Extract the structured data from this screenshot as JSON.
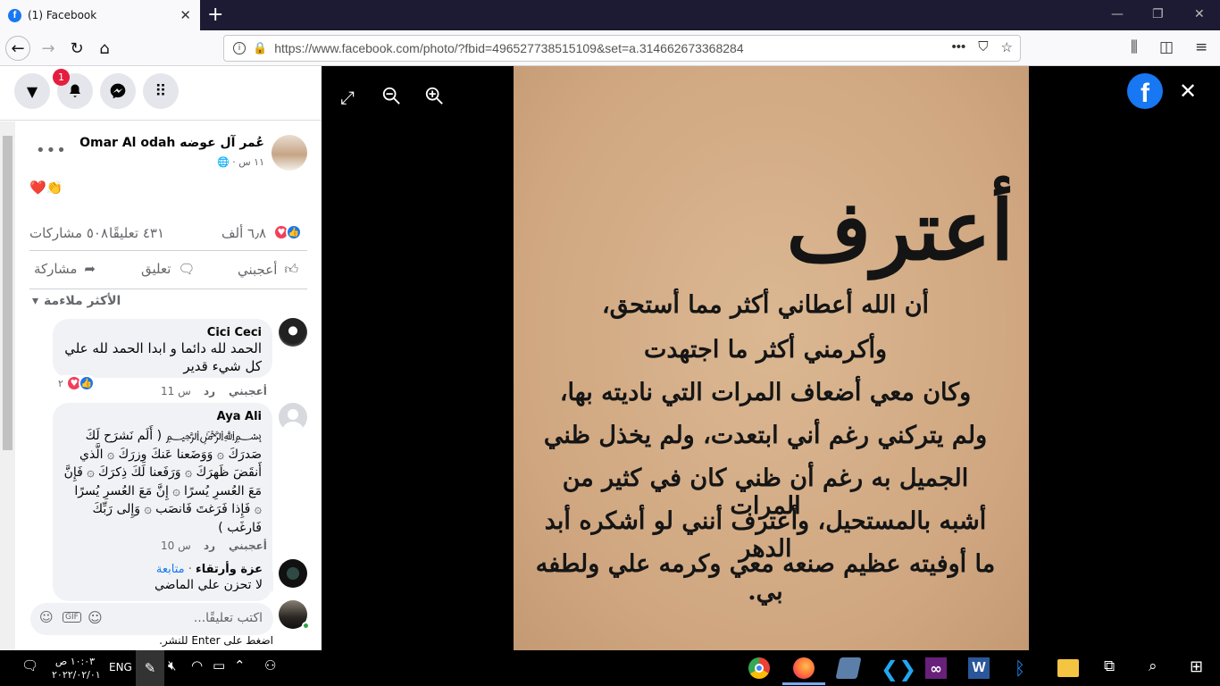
{
  "browser": {
    "tab_title": "(1) Facebook",
    "tab_close": "✕",
    "new_tab": "+",
    "url": "https://www.facebook.com/photo/?fbid=496527738515109&set=a.314662673368284"
  },
  "fb_header": {
    "notification_count": "1"
  },
  "post": {
    "author": "عُمر آل عوضه Omar Al odah",
    "time": "١١ س",
    "emoji": "❤️👏",
    "reaction_count": "٦٫٨ ألف",
    "comments_count": "٤٣١ تعليقًا",
    "shares_count": "٥٠٨ مشاركات",
    "like_label": "أعجبني",
    "comment_label": "تعليق",
    "share_label": "مشاركة",
    "sort_label": "الأكثر ملاءمة"
  },
  "comments": [
    {
      "name": "Cici Ceci",
      "text": "الحمد لله دائما و ابدا الحمد لله علي كل شيء قدير",
      "like": "أعجبني",
      "reply": "رد",
      "time": "11 س",
      "reactions": "٢"
    },
    {
      "name": "Aya Ali",
      "text": "﷽ ( أَلَم نَشرَح لَكَ صَدرَكَ ۞ وَوَضَعنا عَنكَ وِزرَكَ ۞ الَّذي أَنقَضَ ظَهرَكَ ۞ وَرَفَعنا لَكَ ذِكرَكَ ۞ فَإِنَّ مَعَ العُسرِ يُسرًا ۞ إِنَّ مَعَ العُسرِ يُسرًا ۞ فَإِذا فَرَغتَ فَانصَب ۞ وَإِلى رَبِّكَ فَارغَب )",
      "like": "أعجبني",
      "reply": "رد",
      "time": "10 س"
    },
    {
      "name": "عزة وأرتقاء",
      "follow": "متابعة",
      "text": "لا تحزن علي الماضي"
    }
  ],
  "composer": {
    "placeholder": "اكتب تعليقًا...",
    "hint": "اضغط على Enter للنشر."
  },
  "photo": {
    "title": "أعترف",
    "lines": [
      "أن الله أعطاني أكثر مما أستحق،",
      "وأكرمني أكثر ما اجتهدت",
      "وكان معي أضعاف المرات التي ناديته بها،",
      "ولم يتركني رغم أني ابتعدت، ولم يخذل ظني",
      "الجميل به رغم أن ظني كان في كثير من المرات",
      "أشبه بالمستحيل، وأعترف أنني لو أشكره أبد الدهر",
      "ما أوفيته عظيم صنعه معي وكرمه علي ولطفه بي."
    ]
  },
  "taskbar": {
    "lang": "ENG",
    "time": "١٠:٠٣ ص",
    "date": "٢٠٢٢/٠٢/٠١"
  },
  "colors": {
    "fb_blue": "#1877f2",
    "badge_red": "#e41e3f",
    "photo_bg": "#d2ad86"
  }
}
